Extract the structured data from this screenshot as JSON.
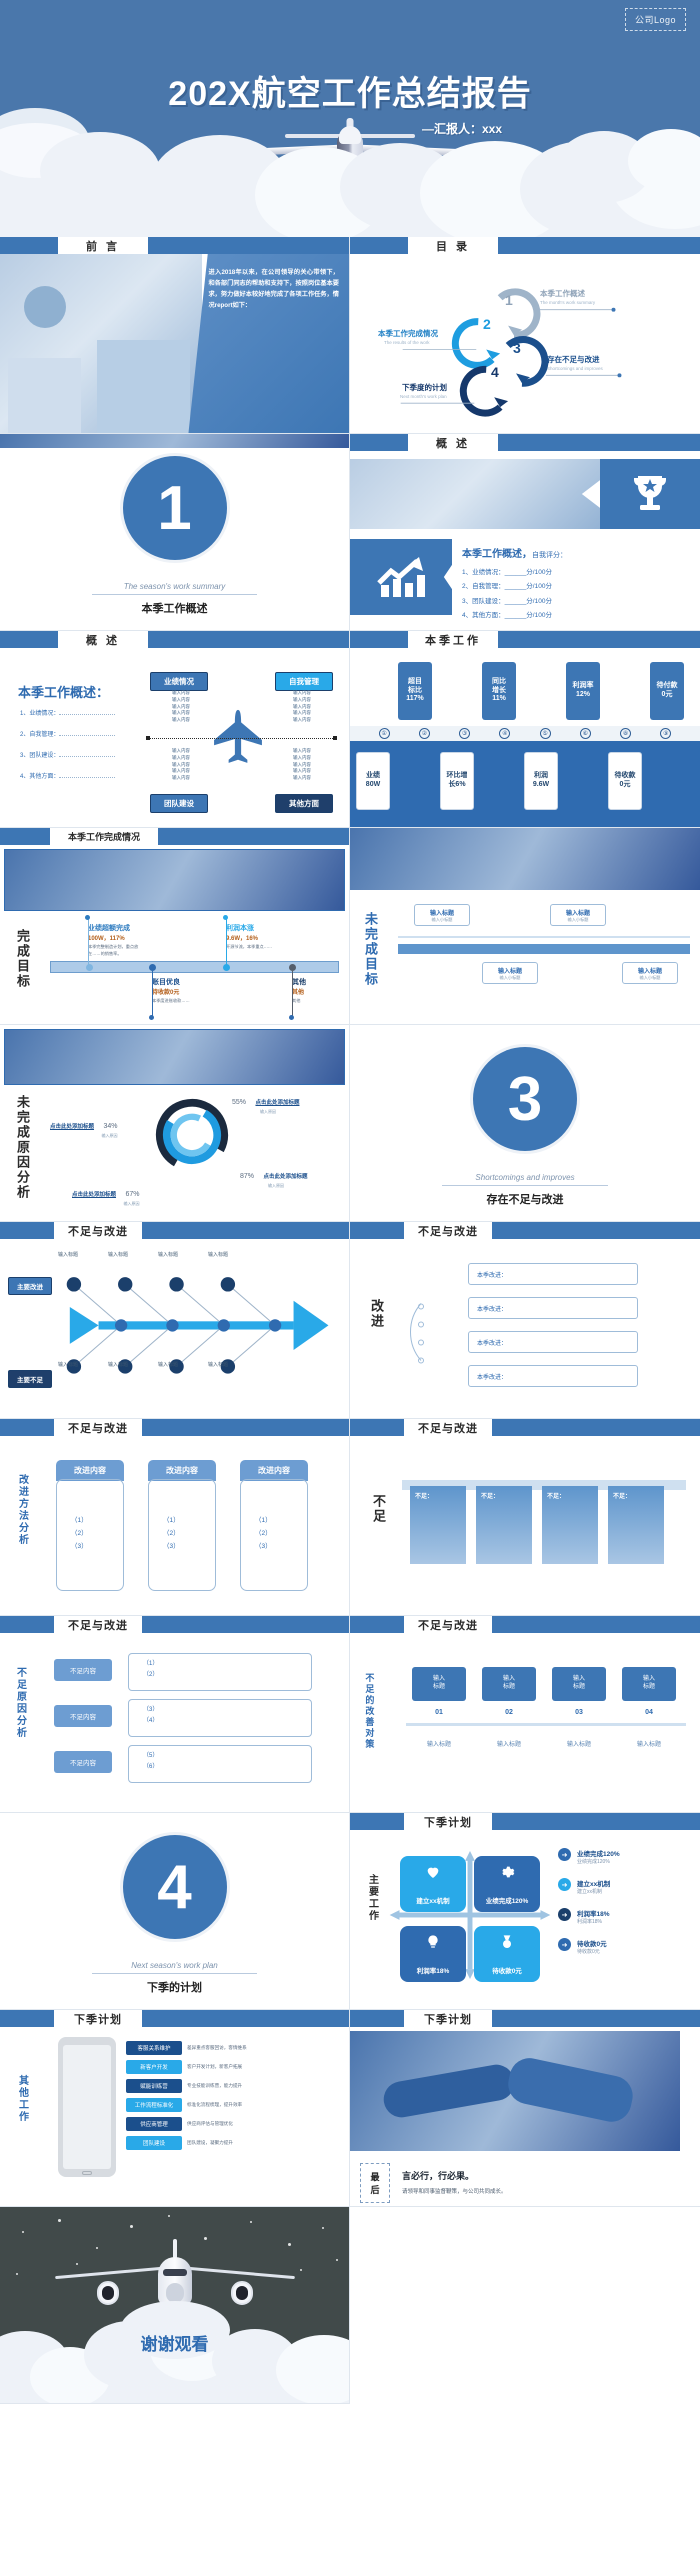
{
  "cover": {
    "logo": "公司Logo",
    "title": "202X航空工作总结报告",
    "subtitle": "—汇报人：xxx"
  },
  "slides": {
    "preface": {
      "header": "前 言",
      "body": "进入2018年以来，在公司领导的关心带领下，和各部门同志的帮助和支持下，按照岗位基本要求，努力做好本较好地完成了各项工作任务，情况report如下："
    },
    "toc": {
      "header": "目 录",
      "items": [
        {
          "num": "1",
          "cn": "本季工作概述",
          "en": "The month's work summary"
        },
        {
          "num": "2",
          "cn": "本季工作完成情况",
          "en": "The results of the work"
        },
        {
          "num": "3",
          "cn": "存在不足与改进",
          "en": "Shortcomings and improves"
        },
        {
          "num": "4",
          "cn": "下季度的计划",
          "en": "Next month's work plan"
        }
      ]
    },
    "section1": {
      "number": "1",
      "en": "The season's work summary",
      "cn": "本季工作概述"
    },
    "overview_score": {
      "header": "概 述",
      "title": "本季工作概述，",
      "title_small": "自我评分：",
      "items": [
        "1、业绩情况：______分/100分",
        "2、自我管理：______分/100分",
        "3、团队建设：______分/100分",
        "4、其他方面：______分/100分"
      ],
      "icons": [
        "trophy-icon",
        "growth-chart-icon"
      ]
    },
    "overview_plane": {
      "header": "概 述",
      "title": "本季工作概述：",
      "list": [
        "1、业绩情况：",
        "2、自我管理：",
        "3、团队建设：",
        "4、其他方面："
      ],
      "quadrants": [
        "业绩情况",
        "自我管理",
        "团队建设",
        "其他方面"
      ],
      "filler": "输入内容"
    },
    "quarter_work": {
      "header": "本季工作",
      "top_chips": [
        {
          "l1": "超目",
          "l2": "标比",
          "v": "117%"
        },
        {
          "l1": "同比",
          "l2": "增长",
          "v": "11%"
        },
        {
          "l1": "利润率",
          "l2": "",
          "v": "12%"
        },
        {
          "l1": "待付款",
          "l2": "",
          "v": "0元"
        }
      ],
      "nums": [
        "①",
        "②",
        "③",
        "④",
        "⑤",
        "⑥",
        "⑧",
        "⑨"
      ],
      "bottom_chips": [
        {
          "l1": "业绩",
          "v": "80W"
        },
        {
          "l1": "环比增",
          "l2": "长6%",
          "v": ""
        },
        {
          "l1": "利润",
          "v": "9.6W"
        },
        {
          "l1": "待收款",
          "v": "0元"
        }
      ]
    },
    "goal_done": {
      "header": "本季工作完成情况",
      "vlabel": "完成目标",
      "nodes": [
        {
          "t": "业绩超额完成",
          "v": "100W，117%",
          "d": "本季完整制造计划，重点放在……的销售率。"
        },
        {
          "t": "账目优良",
          "v": "待收款0元",
          "d": "本季度进账收款……"
        },
        {
          "t": "利润本涨",
          "v": "9.6W，16%",
          "d": "开源节流，本季重点……"
        },
        {
          "t": "其他",
          "v": "其他",
          "d": "其他"
        }
      ]
    },
    "unfinished_goal": {
      "header": "未完成目标",
      "vlabel": "未完成目标",
      "boxes": [
        "输入标题",
        "输入标题",
        "输入标题",
        "输入标题"
      ],
      "sub": "输入小标题"
    },
    "unfinished_reason": {
      "header": "未完成原因分析",
      "vlabel": "未完成原因分析",
      "slices": [
        {
          "pct": "55%",
          "label": "点击此处添加标题",
          "sub": "输入原因"
        },
        {
          "pct": "34%",
          "label": "点击此处添加标题",
          "sub": "输入原因"
        },
        {
          "pct": "87%",
          "label": "点击此处添加标题",
          "sub": "输入原因"
        },
        {
          "pct": "67%",
          "label": "点击此处添加标题",
          "sub": "输入原因"
        }
      ]
    },
    "section3": {
      "number": "3",
      "en": "Shortcomings and improves",
      "cn": "存在不足与改进"
    },
    "fishbone": {
      "header": "不足与改进",
      "left_top": "主要改进",
      "left_bottom": "主要不足",
      "labels": [
        "输入标题",
        "输入标题",
        "输入标题",
        "输入标题"
      ]
    },
    "improve_list": {
      "header": "不足与改进",
      "vlabel": "改进",
      "rows": [
        "本季改进：",
        "本季改进：",
        "本季改进：",
        "本季改进："
      ]
    },
    "improve_methods": {
      "header": "不足与改进",
      "vlabel": "改进方法分析",
      "cards": [
        {
          "head": "改进内容",
          "items": [
            "（1）",
            "（2）",
            "（3）"
          ]
        },
        {
          "head": "改进内容",
          "items": [
            "（1）",
            "（2）",
            "（3）"
          ]
        },
        {
          "head": "改进内容",
          "items": [
            "（1）",
            "（2）",
            "（3）"
          ]
        }
      ]
    },
    "shortfall": {
      "header": "不足与改进",
      "vlabel": "不足",
      "cards": [
        "不足：",
        "不足：",
        "不足：",
        "不足："
      ]
    },
    "shortfall_reason": {
      "header": "不足与改进",
      "vlabel": "不足原因分析",
      "chips": [
        "不足内容",
        "不足内容",
        "不足内容"
      ],
      "items": [
        "（1）",
        "（2）",
        "（3）",
        "（4）",
        "（5）",
        "（6）"
      ]
    },
    "countermeasure": {
      "header": "不足与改进",
      "vlabel": "不足的改善对策",
      "steps": [
        {
          "chip": "输入",
          "chip2": "标题",
          "no": "01",
          "cap": "输入标题"
        },
        {
          "chip": "输入",
          "chip2": "标题",
          "no": "02",
          "cap": "输入标题"
        },
        {
          "chip": "输入",
          "chip2": "标题",
          "no": "03",
          "cap": "输入标题"
        },
        {
          "chip": "输入",
          "chip2": "标题",
          "no": "04",
          "cap": "输入标题"
        }
      ]
    },
    "section4": {
      "number": "4",
      "en": "Next season's work plan",
      "cn": "下季的计划"
    },
    "plan_matrix": {
      "header": "下季计划",
      "vlabel": "主要工作",
      "tiles": [
        {
          "icon": "heart-icon",
          "label": "建立xx机制"
        },
        {
          "icon": "gear-icon",
          "label": "业绩完成120%"
        },
        {
          "icon": "bulb-icon",
          "label": "利润率18%"
        },
        {
          "icon": "medal-icon",
          "label": "待收款0元"
        }
      ],
      "bullets": [
        {
          "t": "业绩完成120%",
          "s": "业绩完成120%"
        },
        {
          "t": "建立xx机制",
          "s": "建立xx机制"
        },
        {
          "t": "利润率18%",
          "s": "利润率18%"
        },
        {
          "t": "待收款0元",
          "s": "待收款0元"
        }
      ]
    },
    "plan_phone": {
      "header": "下季计划",
      "vlabel": "其他工作",
      "rows": [
        {
          "chip": "客服关系维护",
          "text": "差异重点客服回访，客情维系"
        },
        {
          "chip": "新客户开发",
          "text": "客户开发计划，新客户拓展"
        },
        {
          "chip": "赋能训练营",
          "text": "专业技能训练营，能力提升"
        },
        {
          "chip": "工作流程标准化",
          "text": "标准化流程梳理，提升效率"
        },
        {
          "chip": "供应商管理",
          "text": "供应商评估与管理优化"
        },
        {
          "chip": "团队建设",
          "text": "团队建设，凝聚力提升"
        }
      ]
    },
    "final": {
      "header": "下季计划",
      "badge_1": "最",
      "badge_2": "后",
      "title": "言必行，行必果。",
      "sub": "请领导和同事监督鞭策，与公司共同成长。"
    },
    "thanks": {
      "text": "谢谢观看"
    }
  },
  "colors": {
    "brand": "#3d76b4",
    "cover_bg": "#4a77ab",
    "light_blue": "#29a9e8",
    "dark_blue": "#1f3f6b",
    "cloud": "#eef2f8"
  }
}
